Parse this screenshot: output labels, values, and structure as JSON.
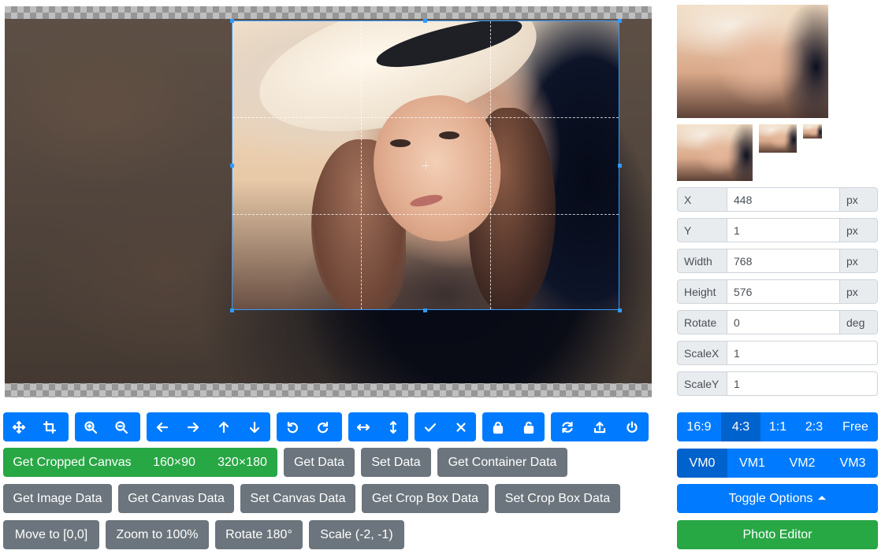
{
  "data_fields": [
    {
      "label": "X",
      "value": "448",
      "unit": "px"
    },
    {
      "label": "Y",
      "value": "1",
      "unit": "px"
    },
    {
      "label": "Width",
      "value": "768",
      "unit": "px"
    },
    {
      "label": "Height",
      "value": "576",
      "unit": "px"
    },
    {
      "label": "Rotate",
      "value": "0",
      "unit": "deg"
    },
    {
      "label": "ScaleX",
      "value": "1",
      "unit": ""
    },
    {
      "label": "ScaleY",
      "value": "1",
      "unit": ""
    }
  ],
  "toolbar_icons": [
    [
      "move-icon",
      "crop-icon"
    ],
    [
      "zoom-in-icon",
      "zoom-out-icon"
    ],
    [
      "arrow-left-icon",
      "arrow-right-icon",
      "arrow-up-icon",
      "arrow-down-icon"
    ],
    [
      "rotate-left-icon",
      "rotate-right-icon"
    ],
    [
      "flip-horizontal-icon",
      "flip-vertical-icon"
    ],
    [
      "check-icon",
      "close-icon"
    ],
    [
      "lock-icon",
      "unlock-icon"
    ],
    [
      "refresh-icon",
      "upload-icon",
      "power-icon"
    ]
  ],
  "cropped_canvas": {
    "label": "Get Cropped Canvas",
    "size1": "160×90",
    "size2": "320×180"
  },
  "buttons": {
    "get_data": "Get Data",
    "set_data": "Set Data",
    "get_container_data": "Get Container Data",
    "get_image_data": "Get Image Data",
    "get_canvas_data": "Get Canvas Data",
    "set_canvas_data": "Set Canvas Data",
    "get_crop_box_data": "Get Crop Box Data",
    "set_crop_box_data": "Set Crop Box Data",
    "move_to": "Move to [0,0]",
    "zoom_to": "Zoom to 100%",
    "rotate_180": "Rotate 180°",
    "scale": "Scale (-2, -1)"
  },
  "aspect_ratios": {
    "options": [
      "16:9",
      "4:3",
      "1:1",
      "2:3",
      "Free"
    ],
    "active": "4:3"
  },
  "view_modes": {
    "options": [
      "VM0",
      "VM1",
      "VM2",
      "VM3"
    ],
    "active": "VM0"
  },
  "toggle_options": "Toggle Options",
  "photo_editor": "Photo Editor",
  "colors": {
    "primary": "#007bff",
    "active": "#0062cc",
    "success": "#28a745",
    "secondary": "#6c757d",
    "crop_border": "#3399ff"
  }
}
